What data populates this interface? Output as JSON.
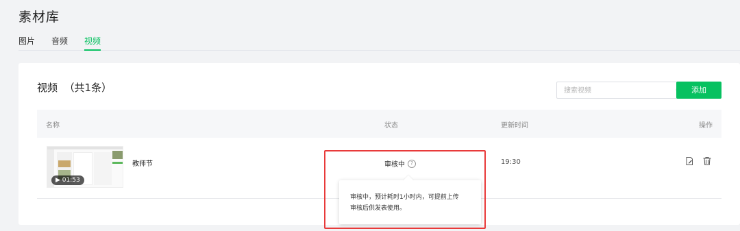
{
  "page": {
    "title": "素材库"
  },
  "tabs": [
    {
      "label": "图片",
      "active": false
    },
    {
      "label": "音频",
      "active": false
    },
    {
      "label": "视频",
      "active": true
    }
  ],
  "section": {
    "title": "视频  （共1条）",
    "search_placeholder": "搜索视频",
    "add_label": "添加"
  },
  "table": {
    "headers": {
      "name": "名称",
      "status": "状态",
      "updated": "更新时间",
      "actions": "操作"
    },
    "rows": [
      {
        "name": "教师节",
        "duration": "▶ 01:53",
        "status": "审核中",
        "updated": "19:30"
      }
    ]
  },
  "tooltip": {
    "line1": "审核中，预计耗时1小时内，可提前上传",
    "line2": "审核后供发表使用。"
  },
  "icons": {
    "search": "search-icon",
    "help": "question-circle-icon",
    "edit": "edit-icon",
    "delete": "trash-icon"
  },
  "colors": {
    "accent": "#07c160",
    "highlight": "#e83a3a"
  }
}
